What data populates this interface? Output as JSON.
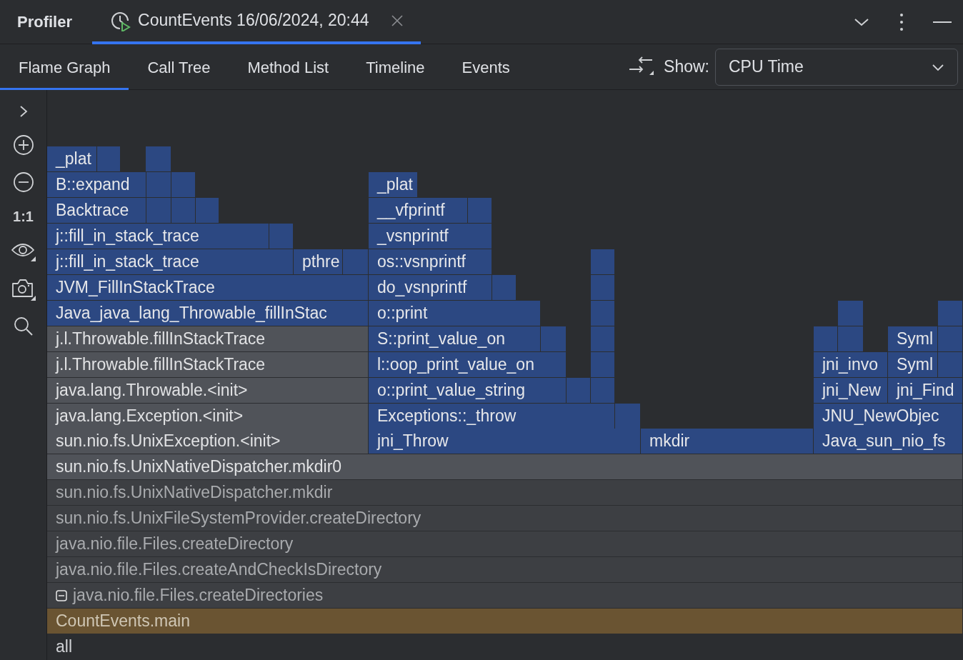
{
  "header": {
    "title": "Profiler",
    "session_tab": {
      "label": "CountEvents 16/06/2024, 20:44",
      "selected": true
    }
  },
  "tabs": [
    {
      "label": "Flame Graph",
      "selected": true
    },
    {
      "label": "Call Tree",
      "selected": false
    },
    {
      "label": "Method List",
      "selected": false
    },
    {
      "label": "Timeline",
      "selected": false
    },
    {
      "label": "Events",
      "selected": false
    }
  ],
  "show": {
    "label": "Show:",
    "value": "CPU Time"
  },
  "toolbar": {
    "actual_size": "1:1"
  },
  "flame_rows": [
    {
      "frames": [
        {
          "label": "_plat",
          "kind": "native"
        },
        {
          "kind": "native"
        },
        {
          "kind": "native"
        }
      ]
    },
    {
      "frames": [
        {
          "label": "B::expand",
          "kind": "native"
        },
        {
          "kind": "native"
        },
        {
          "kind": "native"
        },
        {
          "label": "_plat",
          "kind": "native"
        }
      ]
    },
    {
      "frames": [
        {
          "label": "Backtrace",
          "kind": "native"
        },
        {
          "kind": "native"
        },
        {
          "kind": "native"
        },
        {
          "kind": "native"
        },
        {
          "label": "__vfprintf",
          "kind": "native"
        },
        {
          "kind": "native"
        }
      ]
    },
    {
      "frames": [
        {
          "label": "j::fill_in_stack_trace",
          "kind": "native"
        },
        {
          "kind": "native"
        },
        {
          "label": "_vsnprintf",
          "kind": "native"
        }
      ]
    },
    {
      "frames": [
        {
          "label": "j::fill_in_stack_trace",
          "kind": "native"
        },
        {
          "label": "pthre",
          "kind": "native"
        },
        {
          "kind": "native"
        },
        {
          "label": "os::vsnprintf",
          "kind": "native"
        },
        {
          "kind": "native"
        }
      ]
    },
    {
      "frames": [
        {
          "label": "JVM_FillInStackTrace",
          "kind": "native"
        },
        {
          "label": "do_vsnprintf",
          "kind": "native"
        },
        {
          "kind": "native"
        },
        {
          "kind": "native"
        }
      ]
    },
    {
      "frames": [
        {
          "label": "Java_java_lang_Throwable_fillInStac",
          "kind": "native"
        },
        {
          "label": "o::print",
          "kind": "native"
        },
        {
          "kind": "native"
        },
        {
          "kind": "native"
        },
        {
          "kind": "native"
        }
      ]
    },
    {
      "frames": [
        {
          "label": "j.l.Throwable.fillInStackTrace",
          "kind": "java"
        },
        {
          "label": "S::print_value_on",
          "kind": "native"
        },
        {
          "kind": "native"
        },
        {
          "kind": "native"
        },
        {
          "kind": "native"
        },
        {
          "kind": "native"
        },
        {
          "label": "Syml",
          "kind": "native"
        },
        {
          "kind": "native"
        }
      ]
    },
    {
      "frames": [
        {
          "label": "j.l.Throwable.fillInStackTrace",
          "kind": "java"
        },
        {
          "label": "l::oop_print_value_on",
          "kind": "native"
        },
        {
          "kind": "native"
        },
        {
          "label": "jni_invo",
          "kind": "native"
        },
        {
          "label": "Syml",
          "kind": "native"
        },
        {
          "kind": "native"
        }
      ]
    },
    {
      "frames": [
        {
          "label": "java.lang.Throwable.<init>",
          "kind": "java"
        },
        {
          "label": "o::print_value_string",
          "kind": "native"
        },
        {
          "kind": "native"
        },
        {
          "kind": "native"
        },
        {
          "label": "jni_New",
          "kind": "native"
        },
        {
          "label": "jni_Find",
          "kind": "native"
        }
      ]
    },
    {
      "frames": [
        {
          "label": "java.lang.Exception.<init>",
          "kind": "java"
        },
        {
          "label": "Exceptions::_throw",
          "kind": "native"
        },
        {
          "kind": "native"
        },
        {
          "label": "JNU_NewObjec",
          "kind": "native"
        }
      ]
    },
    {
      "frames": [
        {
          "label": "sun.nio.fs.UnixException.<init>",
          "kind": "java"
        },
        {
          "label": "jni_Throw",
          "kind": "native"
        },
        {
          "label": "mkdir",
          "kind": "native"
        },
        {
          "label": "Java_sun_nio_fs",
          "kind": "native"
        }
      ]
    },
    {
      "frames": [
        {
          "label": "sun.nio.fs.UnixNativeDispatcher.mkdir0",
          "kind": "java"
        }
      ]
    },
    {
      "frames": [
        {
          "label": "sun.nio.fs.UnixNativeDispatcher.mkdir",
          "kind": "dim"
        }
      ]
    },
    {
      "frames": [
        {
          "label": "sun.nio.fs.UnixFileSystemProvider.createDirectory",
          "kind": "dim"
        }
      ]
    },
    {
      "frames": [
        {
          "label": "java.nio.file.Files.createDirectory",
          "kind": "dim"
        }
      ]
    },
    {
      "frames": [
        {
          "label": "java.nio.file.Files.createAndCheckIsDirectory",
          "kind": "dim"
        }
      ]
    },
    {
      "frames": [
        {
          "label": "java.nio.file.Files.createDirectories",
          "kind": "dim",
          "expanded": true
        }
      ]
    },
    {
      "frames": [
        {
          "label": "CountEvents.main",
          "kind": "selected"
        }
      ]
    },
    {
      "frames": [
        {
          "label": "all",
          "kind": "root"
        }
      ]
    }
  ]
}
